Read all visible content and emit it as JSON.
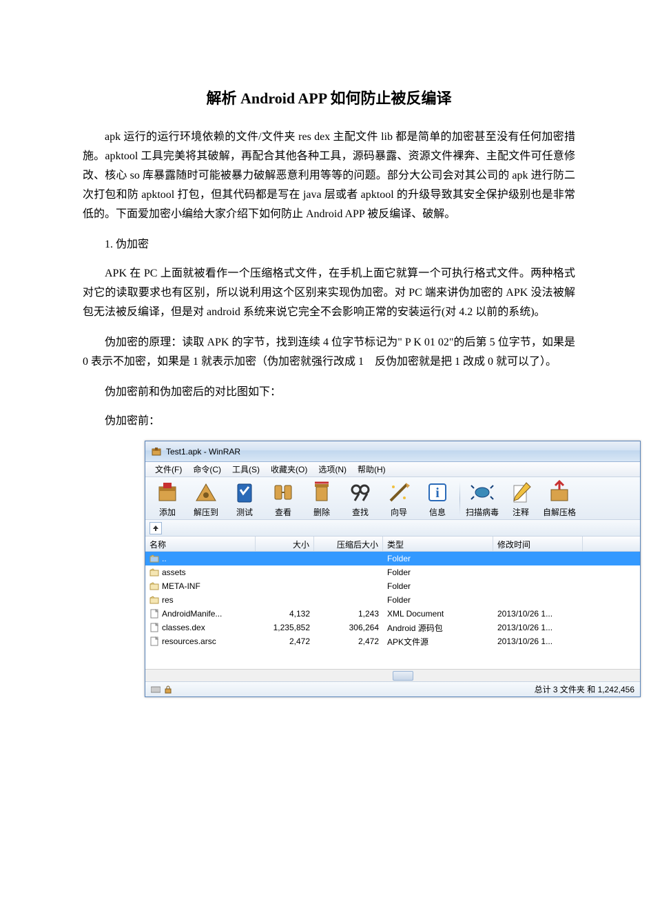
{
  "doc": {
    "title": "解析 Android APP 如何防止被反编译",
    "p1": "apk 运行的运行环境依赖的文件/文件夹 res dex 主配文件 lib 都是简单的加密甚至没有任何加密措施。apktool 工具完美将其破解，再配合其他各种工具，源码暴露、资源文件裸奔、主配文件可任意修改、核心 so 库暴露随时可能被暴力破解恶意利用等等的问题。部分大公司会对其公司的 apk 进行防二次打包和防 apktool 打包，但其代码都是写在 java 层或者 apktool 的升级导致其安全保护级别也是非常低的。下面爱加密小编给大家介绍下如何防止 Android APP 被反编译、破解。",
    "sec1": "1. 伪加密",
    "p2": "APK 在 PC 上面就被看作一个压缩格式文件，在手机上面它就算一个可执行格式文件。两种格式对它的读取要求也有区别，所以说利用这个区别来实现伪加密。对 PC 端来讲伪加密的 APK 没法被解包无法被反编译，但是对 android 系统来说它完全不会影响正常的安装运行(对 4.2 以前的系统)。",
    "p3": "伪加密的原理：读取 APK 的字节，找到连续 4 位字节标记为\" P K 01 02\"的后第 5 位字节，如果是 0 表示不加密，如果是 1 就表示加密（伪加密就强行改成 1　反伪加密就是把 1 改成 0 就可以了）。",
    "p4": "伪加密前和伪加密后的对比图如下：",
    "p5": "伪加密前："
  },
  "winrar": {
    "title": "Test1.apk - WinRAR",
    "menus": [
      "文件(F)",
      "命令(C)",
      "工具(S)",
      "收藏夹(O)",
      "选项(N)",
      "帮助(H)"
    ],
    "tools": [
      "添加",
      "解压到",
      "测试",
      "查看",
      "删除",
      "查找",
      "向导",
      "信息",
      "扫描病毒",
      "注释",
      "自解压格"
    ],
    "cols": {
      "name": "名称",
      "size": "大小",
      "comp": "压缩后大小",
      "type": "类型",
      "date": "修改时间"
    },
    "rows": [
      {
        "name": "..",
        "size": "",
        "comp": "",
        "type": "Folder",
        "date": "",
        "selected": true,
        "icon": "up"
      },
      {
        "name": "assets",
        "size": "",
        "comp": "",
        "type": "Folder",
        "date": "",
        "icon": "folder"
      },
      {
        "name": "META-INF",
        "size": "",
        "comp": "",
        "type": "Folder",
        "date": "",
        "icon": "folder"
      },
      {
        "name": "res",
        "size": "",
        "comp": "",
        "type": "Folder",
        "date": "",
        "icon": "folder"
      },
      {
        "name": "AndroidManife...",
        "size": "4,132",
        "comp": "1,243",
        "type": "XML Document",
        "date": "2013/10/26 1...",
        "icon": "file"
      },
      {
        "name": "classes.dex",
        "size": "1,235,852",
        "comp": "306,264",
        "type": "Android 源码包",
        "date": "2013/10/26 1...",
        "icon": "file"
      },
      {
        "name": "resources.arsc",
        "size": "2,472",
        "comp": "2,472",
        "type": "APK文件源",
        "date": "2013/10/26 1...",
        "icon": "file"
      }
    ],
    "status": "总计 3 文件夹 和 1,242,456"
  }
}
